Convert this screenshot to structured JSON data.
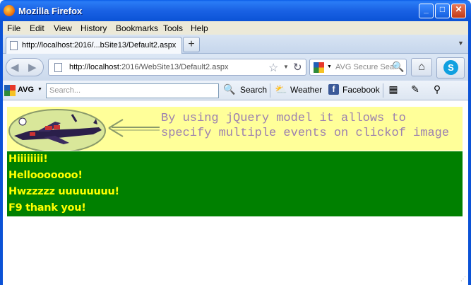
{
  "window": {
    "title": "Mozilla Firefox"
  },
  "menu": {
    "items": [
      "File",
      "Edit",
      "View",
      "History",
      "Bookmarks",
      "Tools",
      "Help"
    ]
  },
  "tab": {
    "label": "http://localhost:2016/...bSite13/Default2.aspx",
    "new_tab_label": "+"
  },
  "navigation": {
    "url_host": "http://localhost",
    "url_rest": ":2016/WebSite13/Default2.aspx",
    "search_placeholder": "AVG Secure Sear"
  },
  "avg_toolbar": {
    "brand": "AVG",
    "search_placeholder": "Search...",
    "search_button": "Search",
    "weather": "Weather",
    "facebook": "Facebook"
  },
  "page": {
    "banner_line1": "By using jQuery model it allows to",
    "banner_line2": "specify multiple events on clickof image",
    "green_lines": [
      "Hiiiiiiii!",
      "Hellooooooo!",
      "Hwzzzzz uuuuuuuu!",
      "F9 thank you!"
    ]
  },
  "colors": {
    "titlebar": "#0b52d6",
    "banner_bg": "#ffff99",
    "banner_text": "#9b7fb0",
    "green_bg": "#008000",
    "green_text": "#ffff00"
  }
}
